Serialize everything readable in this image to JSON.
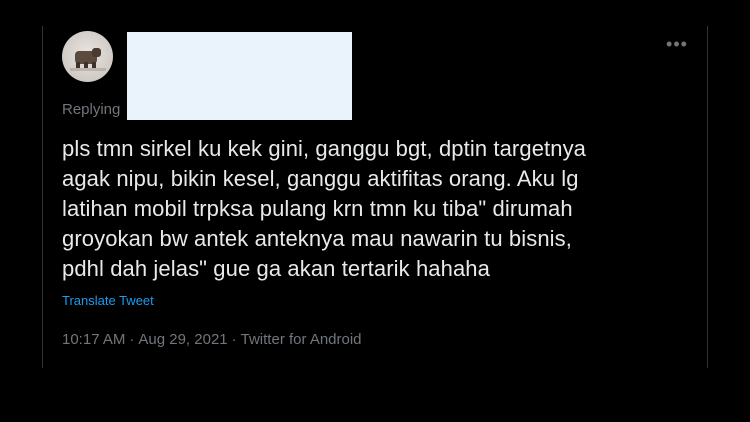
{
  "tweet": {
    "replying_label": "Replying",
    "text": "pls tmn sirkel ku kek gini, ganggu bgt, dptin targetnya\nagak nipu, bikin kesel, ganggu aktifitas orang. Aku lg\nlatihan mobil trpksa pulang krn tmn ku tiba\" dirumah\ngroyokan bw antek anteknya mau nawarin tu bisnis,\npdhl dah jelas\" gue ga akan tertarik hahaha",
    "translate_label": "Translate Tweet",
    "time": "10:17 AM",
    "date": "Aug 29, 2021",
    "source": "Twitter for Android",
    "separator": "·",
    "more_icon": "more-horizontal-icon"
  },
  "colors": {
    "background": "#000000",
    "text_primary": "#e7e9ea",
    "text_secondary": "#71767b",
    "link": "#1d9bf0",
    "redaction": "#eaf3fb",
    "border": "#2f3336"
  }
}
